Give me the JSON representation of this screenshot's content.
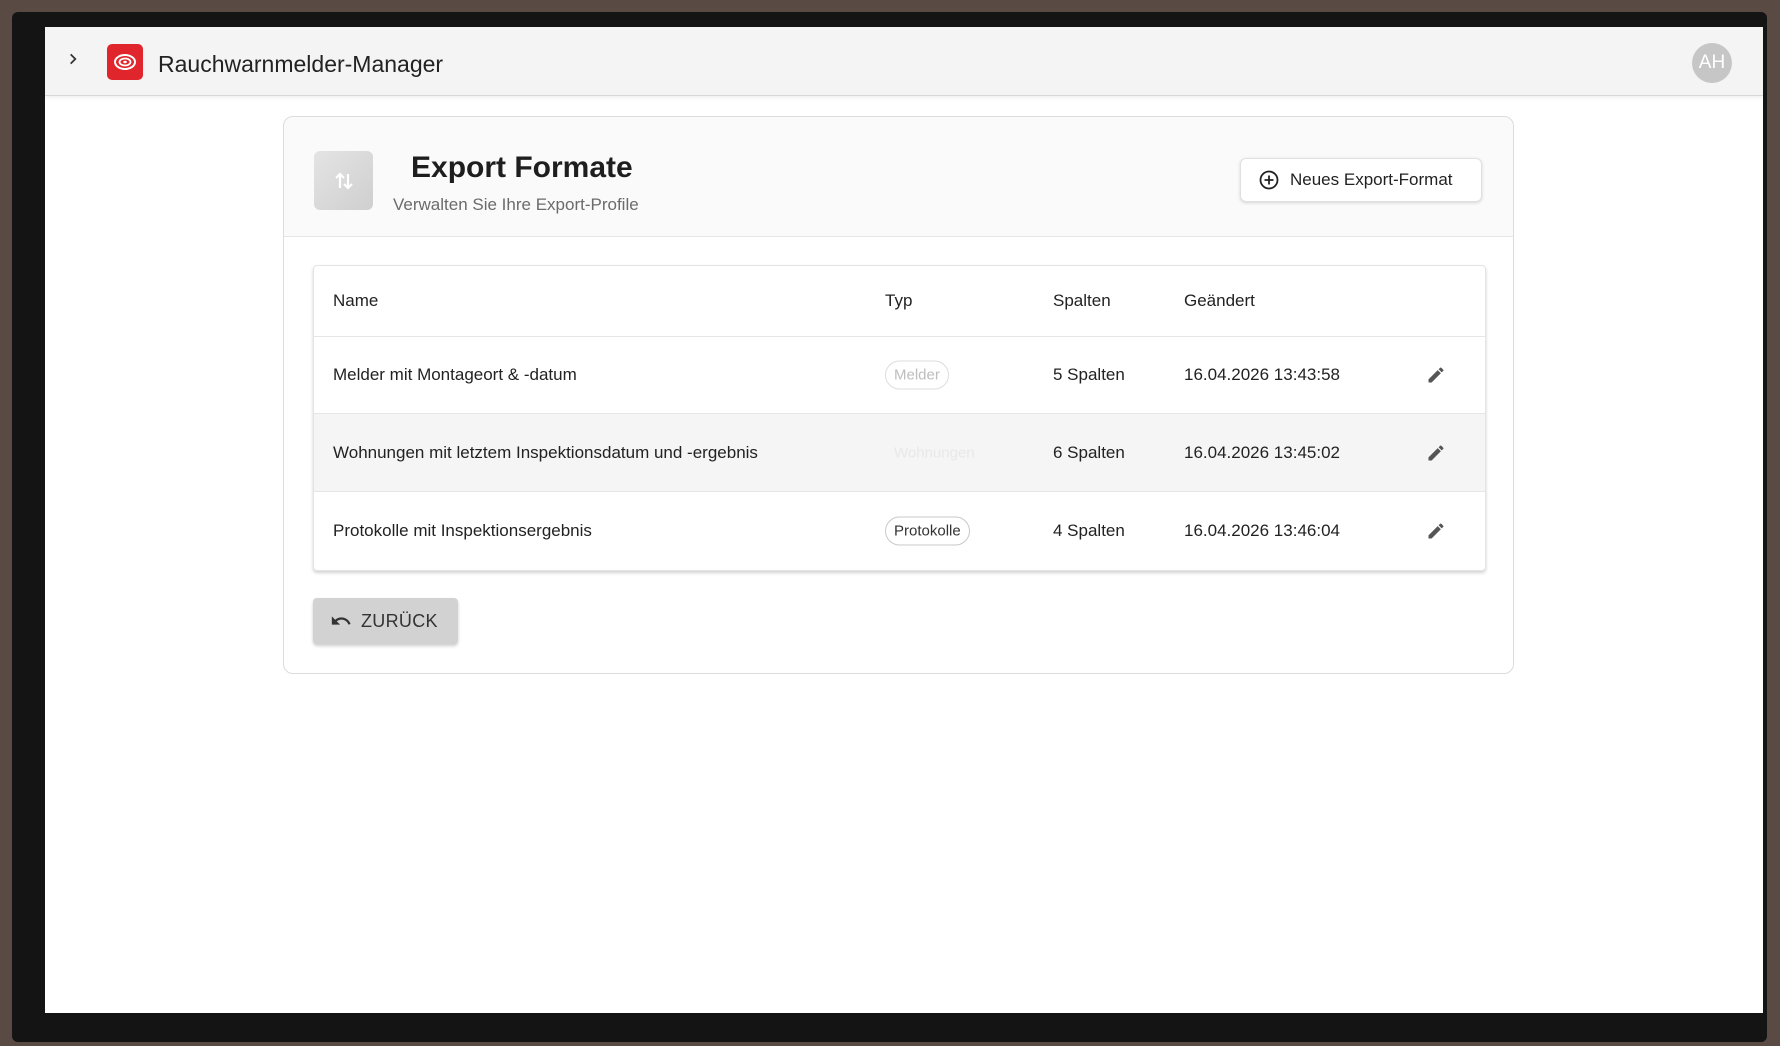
{
  "app": {
    "title": "Rauchwarnmelder-Manager",
    "user_initials": "AH",
    "brand_color": "#e0262c"
  },
  "card": {
    "title": "Export Formate",
    "subtitle": "Verwalten Sie Ihre Export-Profile",
    "header_icon": "swap-vertical-icon",
    "new_button_label": "Neues Export-Format"
  },
  "table": {
    "columns": [
      "Name",
      "Typ",
      "Spalten",
      "Geändert"
    ],
    "rows": [
      {
        "name": "Melder mit Montageort & -datum",
        "typ": "Melder",
        "spalten": "5 Spalten",
        "geaendert": "16.04.2026 13:43:58"
      },
      {
        "name": "Wohnungen mit letztem Inspektionsdatum und -ergebnis",
        "typ": "Wohnungen",
        "spalten": "6 Spalten",
        "geaendert": "16.04.2026 13:45:02"
      },
      {
        "name": "Protokolle mit Inspektionsergebnis",
        "typ": "Protokolle",
        "spalten": "4 Spalten",
        "geaendert": "16.04.2026 13:46:04"
      }
    ]
  },
  "back_button_label": "ZURÜCK"
}
